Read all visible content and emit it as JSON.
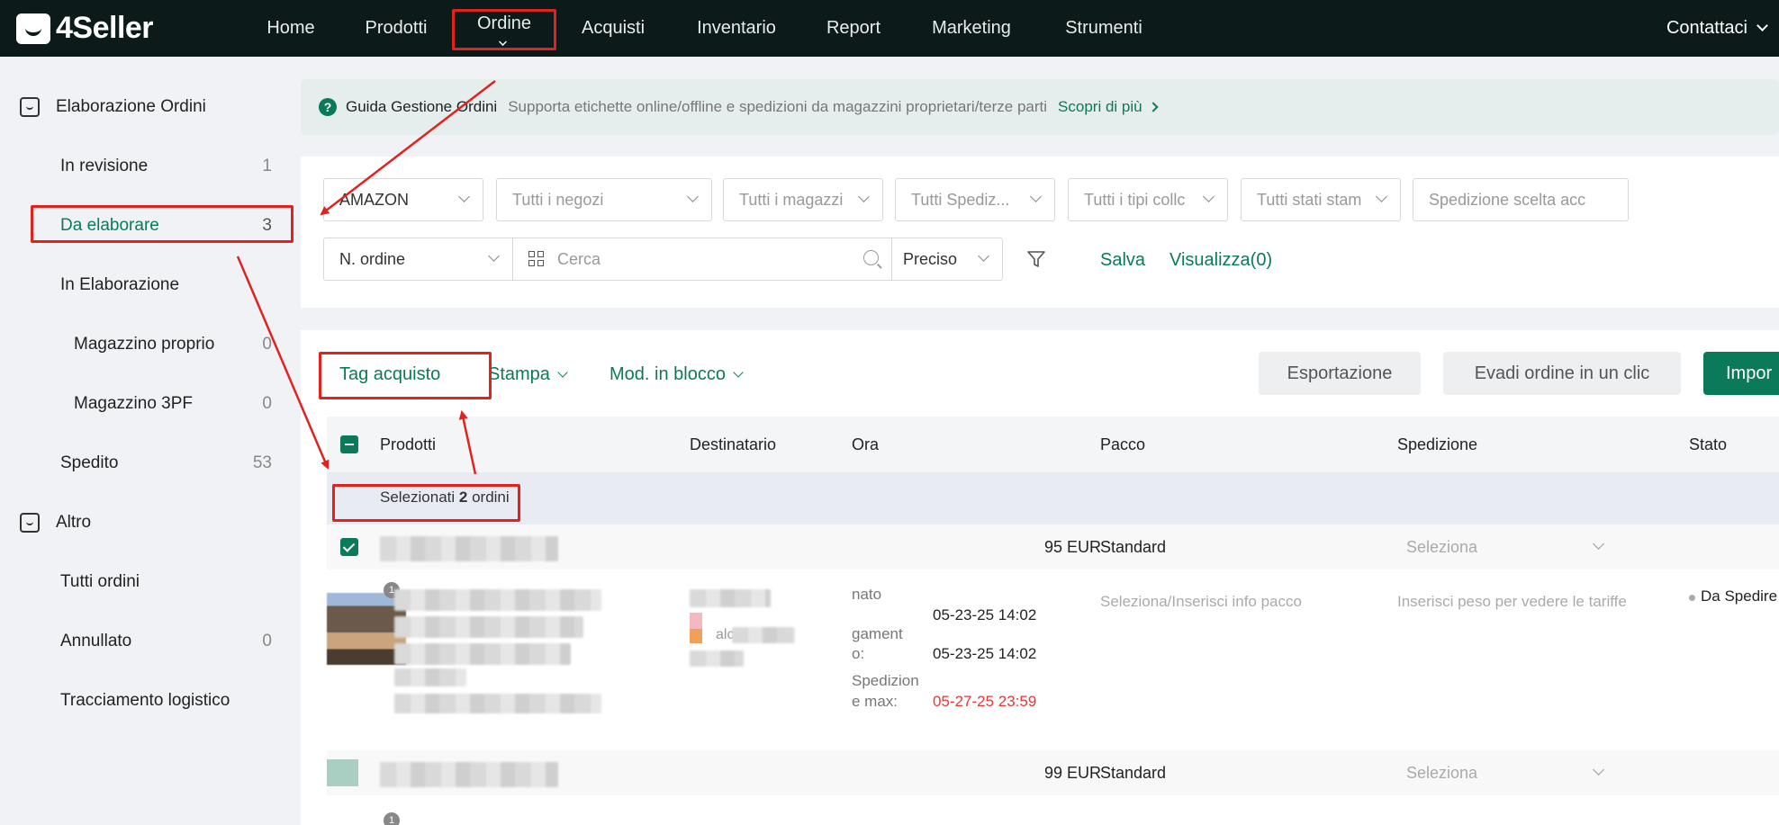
{
  "nav": {
    "logo": "4Seller",
    "items": [
      "Home",
      "Prodotti",
      "Ordine",
      "Acquisti",
      "Inventario",
      "Report",
      "Marketing",
      "Strumenti"
    ],
    "contact": "Contattaci"
  },
  "sidebar": {
    "section1": "Elaborazione Ordini",
    "in_revisione": {
      "label": "In revisione",
      "count": "1"
    },
    "da_elaborare": {
      "label": "Da elaborare",
      "count": "3"
    },
    "in_elaborazione": {
      "label": "In Elaborazione"
    },
    "magazzino_proprio": {
      "label": "Magazzino proprio",
      "count": "0"
    },
    "magazzino_3pf": {
      "label": "Magazzino 3PF",
      "count": "0"
    },
    "spedito": {
      "label": "Spedito",
      "count": "53"
    },
    "section2": "Altro",
    "tutti_ordini": {
      "label": "Tutti ordini"
    },
    "annullato": {
      "label": "Annullato",
      "count": "0"
    },
    "tracciamento": {
      "label": "Tracciamento logistico"
    }
  },
  "banner": {
    "title": "Guida Gestione Ordini",
    "desc": "Supporta etichette online/offline e spedizioni da magazzini proprietari/terze parti",
    "link": "Scopri di più"
  },
  "filters": {
    "platform": "AMAZON",
    "negozi": "Tutti i negozi",
    "magazzini": "Tutti i magazzi",
    "spedizioni": "Tutti Spediz...",
    "tipi": "Tutti i tipi collc",
    "stati": "Tutti stati stam",
    "spedizione_scelta": "Spedizione scelta acc",
    "search_field": "N. ordine",
    "search_placeholder": "Cerca",
    "match": "Preciso",
    "salva": "Salva",
    "visualizza": "Visualizza(0)"
  },
  "actions": {
    "tag": "Tag acquisto",
    "stampa": "Stampa",
    "mod": "Mod. in blocco",
    "export": "Esportazione",
    "evadi": "Evadi ordine in un clic",
    "import": "Impor"
  },
  "table": {
    "headers": [
      "Prodotti",
      "Destinatario",
      "Ora",
      "Pacco",
      "Spedizione",
      "Stato"
    ],
    "selected_prefix": "Selezionati ",
    "selected_count": "2",
    "selected_suffix": " ordini",
    "rows": [
      {
        "amount": "95 EUR",
        "package": "Standard",
        "shipping": "Seleziona"
      },
      {
        "amount": "99 EUR",
        "package": "Standard",
        "shipping": "Seleziona"
      }
    ],
    "detail": {
      "time_label1a": "nato",
      "time_value1": "05-23-25 14:02",
      "time_label2a": "gament",
      "time_label2b": "o:",
      "time_value2": "05-23-25 14:02",
      "time_label3a": "Spedizion",
      "time_label3b": "e max:",
      "time_value3": "05-27-25 23:59",
      "pacco_hint": "Seleziona/Inserisci info pacco",
      "spedizione_hint": "Inserisci peso per vedere le tariffe",
      "status": "Da Spedire",
      "recipient_fragment": "alc",
      "badge": "1"
    }
  },
  "colors": {
    "brand": "#0a7a5a",
    "nav_bg": "#0d1a1a",
    "annotation": "#e0231f",
    "deadline": "#e03a3a"
  }
}
